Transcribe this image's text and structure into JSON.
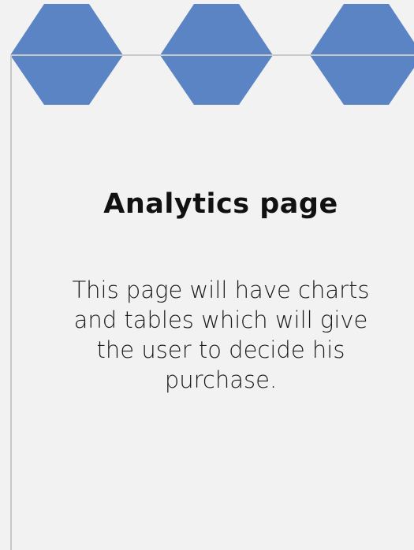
{
  "theme": {
    "background": "#f2f2f2",
    "hexagon_fill": "#5b84c4",
    "border_line": "#c8c8c8",
    "text_color": "#111111"
  },
  "decoration": {
    "shapes": [
      "hexagon-1",
      "hexagon-2",
      "hexagon-3"
    ]
  },
  "main": {
    "title": "Analytics page",
    "description": "This page will have charts and tables which will give the user to decide his purchase."
  }
}
